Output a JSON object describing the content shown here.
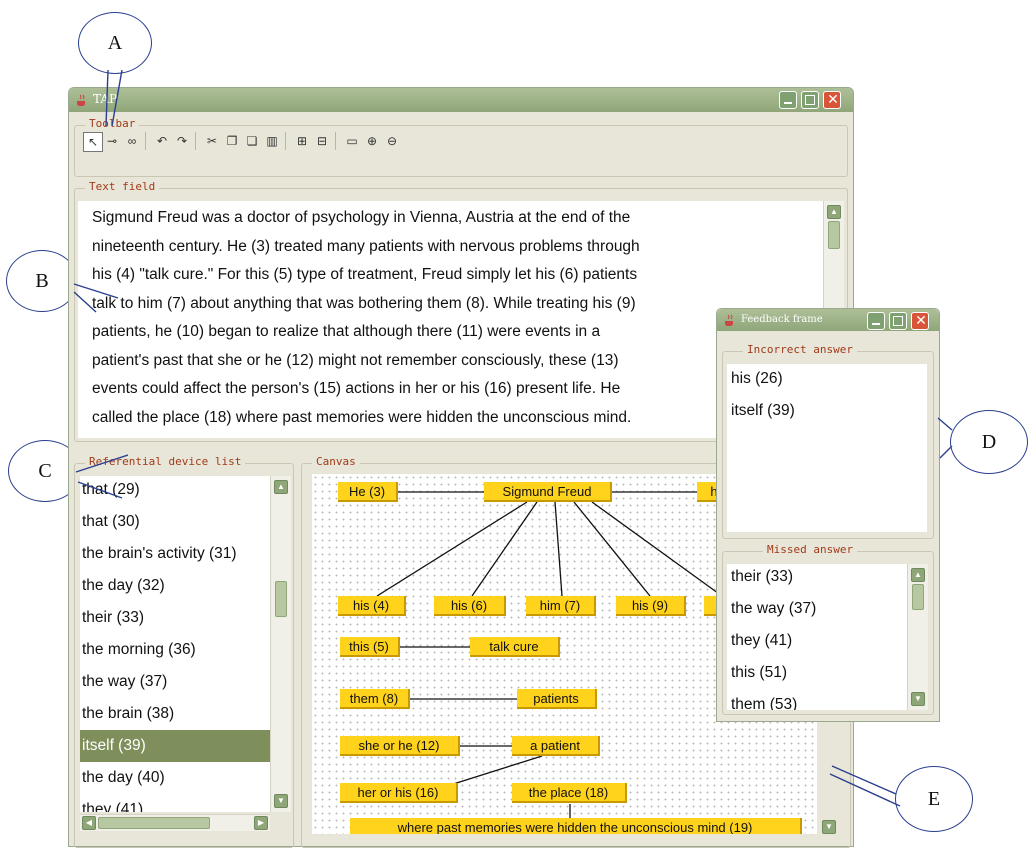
{
  "callouts": {
    "a": "A",
    "b": "B",
    "c": "C",
    "d": "D",
    "e": "E"
  },
  "window": {
    "title": "TAP"
  },
  "toolbar": {
    "label": "Toolbar",
    "buttons": [
      {
        "name": "select-pointer-icon",
        "glyph": "↖"
      },
      {
        "name": "connect-nodes-icon",
        "glyph": "⊸"
      },
      {
        "name": "find-binoculars-icon",
        "glyph": "∞"
      },
      {
        "name": "undo-icon",
        "glyph": "↶"
      },
      {
        "name": "redo-icon",
        "glyph": "↷"
      },
      {
        "name": "cut-icon",
        "glyph": "✂"
      },
      {
        "name": "copy-icon",
        "glyph": "❐"
      },
      {
        "name": "paste-icon",
        "glyph": "❏"
      },
      {
        "name": "delete-icon",
        "glyph": "▥"
      },
      {
        "name": "group-icon",
        "glyph": "⊞"
      },
      {
        "name": "ungroup-icon",
        "glyph": "⊟"
      },
      {
        "name": "fit-view-icon",
        "glyph": "▭"
      },
      {
        "name": "zoom-in-icon",
        "glyph": "⊕"
      },
      {
        "name": "zoom-out-icon",
        "glyph": "⊖"
      }
    ]
  },
  "text_field": {
    "label": "Text field",
    "lines": [
      "Sigmund Freud was a doctor of psychology in Vienna, Austria at the end of the",
      "nineteenth century. He (3) treated many patients with nervous problems through",
      "his (4) \"talk cure.\" For this (5) type of treatment, Freud simply let his (6) patients",
      "talk to him (7) about anything that was bothering them (8). While treating his (9)",
      "patients, he (10) began to realize that although there (11) were events in a",
      "patient's past that she or he (12) might not remember consciously, these (13)",
      "events could affect the person's (15) actions in her or his (16) present life. He",
      "called the place (18) where past memories were hidden the unconscious mind."
    ]
  },
  "referential_list": {
    "label": "Referential device list",
    "items": [
      "that (29)",
      "that (30)",
      "the brain's activity (31)",
      "the day (32)",
      "their (33)",
      "the morning (36)",
      "the way (37)",
      "the brain (38)",
      "itself (39)",
      "the day (40)",
      "they (41)"
    ],
    "selected": "itself (39)"
  },
  "canvas": {
    "label": "Canvas",
    "nodes": {
      "he3": "He (3)",
      "freud": "Sigmund Freud",
      "he10": "he (10)",
      "his4": "his (4)",
      "his6": "his (6)",
      "him7": "him (7)",
      "his9": "his (9)",
      "he_extra": "he (10)",
      "this5": "this (5)",
      "talkcure": "talk cure",
      "them8": "them (8)",
      "patients": "patients",
      "sheorhe12": "she or he (12)",
      "apatient": "a patient",
      "herorhis16": "her or his (16)",
      "place18": "the place (18)",
      "unconscious19": "where past memories were hidden the unconscious mind (19)"
    },
    "node_color": "#ffd21c"
  },
  "feedback": {
    "title": "Feedback frame",
    "incorrect_label": "Incorrect answer",
    "incorrect": [
      "his (26)",
      "itself (39)"
    ],
    "missed_label": "Missed answer",
    "missed": [
      "their (33)",
      "the way (37)",
      "they (41)",
      "this (51)",
      "them (53)"
    ]
  },
  "colors": {
    "titlebar": "#8fa679",
    "group_label": "#a23a1a",
    "selection": "#7f8f5c",
    "close": "#d8553a"
  }
}
